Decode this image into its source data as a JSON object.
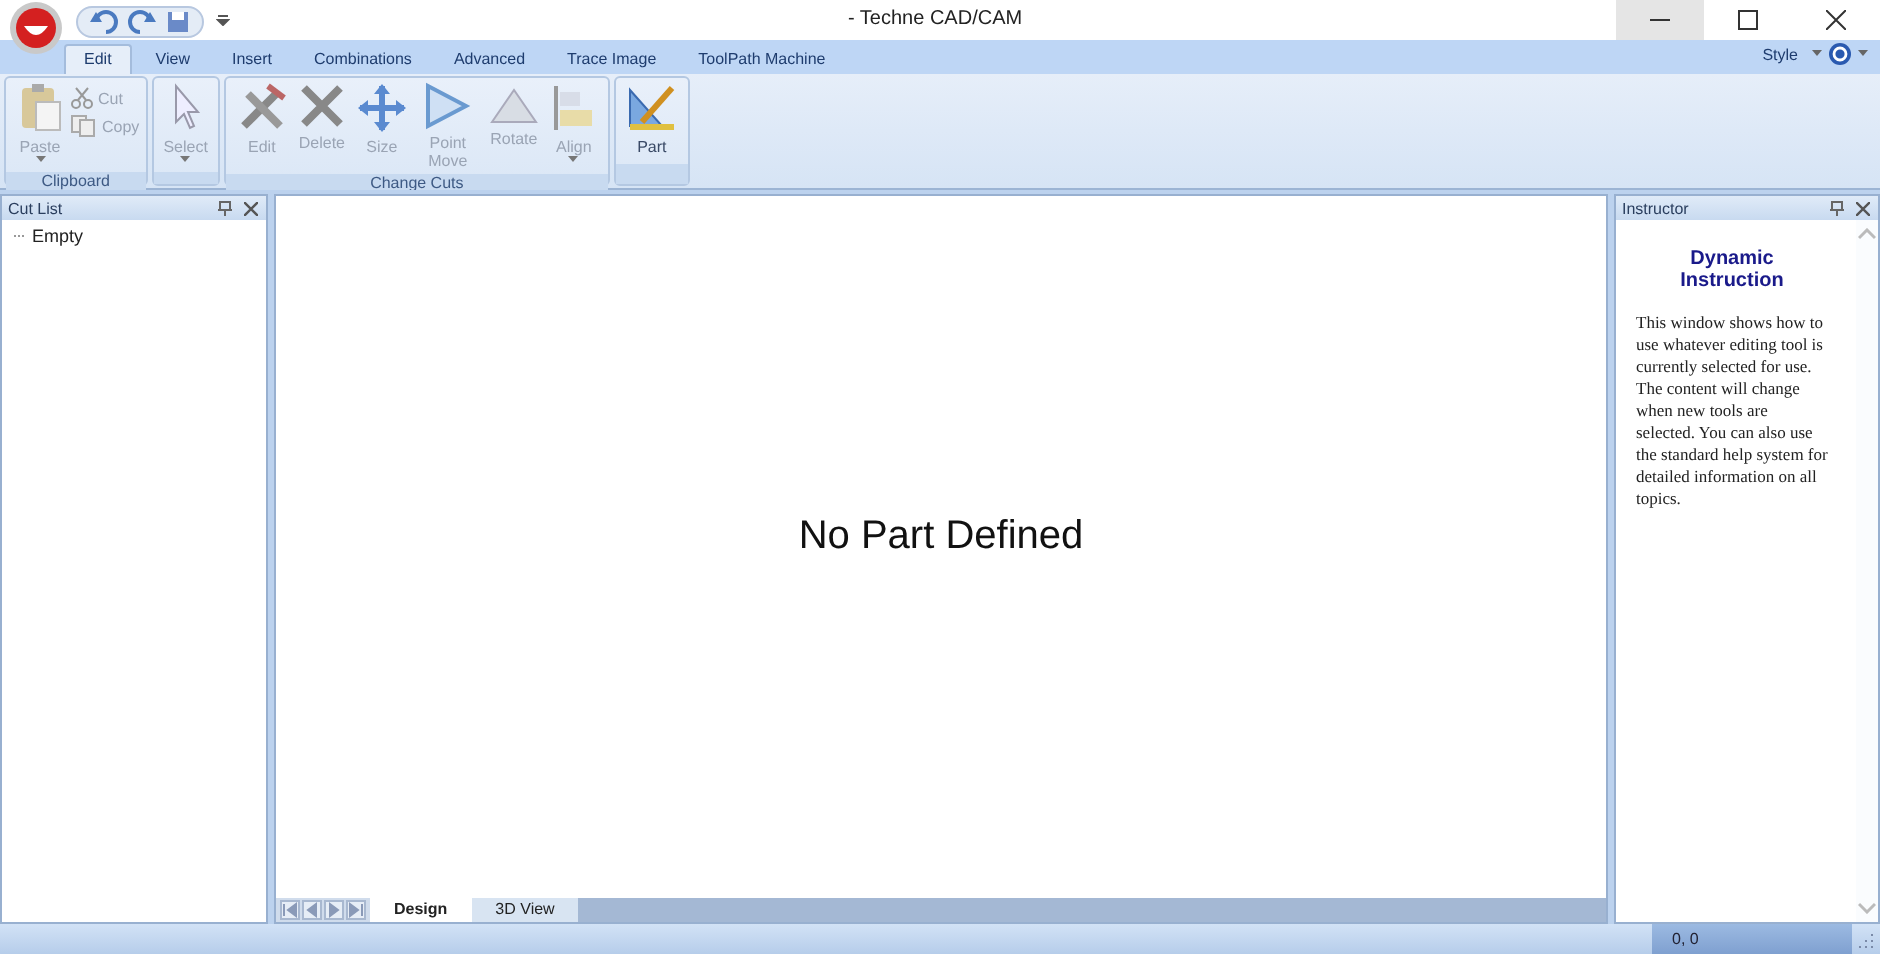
{
  "window": {
    "title": "- Techne CAD/CAM"
  },
  "tabs": [
    {
      "label": "Edit",
      "selected": true
    },
    {
      "label": "View",
      "selected": false
    },
    {
      "label": "Insert",
      "selected": false
    },
    {
      "label": "Combinations",
      "selected": false
    },
    {
      "label": "Advanced",
      "selected": false
    },
    {
      "label": "Trace Image",
      "selected": false
    },
    {
      "label": "ToolPath  Machine",
      "selected": false
    }
  ],
  "style_menu": {
    "label": "Style"
  },
  "ribbon_groups": [
    {
      "label": "Clipboard",
      "buttons": [
        {
          "kind": "large",
          "label": "Paste",
          "dropdown": true,
          "disabled": true
        },
        {
          "kind": "small",
          "label": "Cut",
          "disabled": true
        },
        {
          "kind": "small",
          "label": "Copy",
          "disabled": true
        }
      ]
    },
    {
      "buttons": [
        {
          "kind": "large",
          "label": "Select",
          "dropdown": true,
          "disabled": true
        }
      ]
    },
    {
      "label": "Change Cuts",
      "buttons": [
        {
          "kind": "large",
          "label": "Edit",
          "disabled": true
        },
        {
          "kind": "large",
          "label": "Delete",
          "disabled": true
        },
        {
          "kind": "large",
          "label": "Size",
          "disabled": true
        },
        {
          "kind": "large",
          "label": "Point Move",
          "disabled": true
        },
        {
          "kind": "large",
          "label": "Rotate",
          "disabled": true
        },
        {
          "kind": "large",
          "label": "Align",
          "dropdown": true,
          "disabled": true
        }
      ]
    },
    {
      "buttons": [
        {
          "kind": "large",
          "label": "Part",
          "disabled": false
        }
      ]
    }
  ],
  "cut_list": {
    "title": "Cut List",
    "items": [
      "Empty"
    ]
  },
  "canvas": {
    "message": "No Part Defined"
  },
  "sheet_tabs": [
    {
      "label": "Design",
      "selected": true
    },
    {
      "label": "3D View",
      "selected": false
    }
  ],
  "instructor": {
    "title": "Instructor",
    "heading": "Dynamic Instruction",
    "text": "This window shows how to use whatever editing tool is currently selected for use. The content will change when new tools are selected. You can also use the standard help system for detailed information on all topics."
  },
  "status_bar": {
    "coordinates": "0, 0"
  }
}
